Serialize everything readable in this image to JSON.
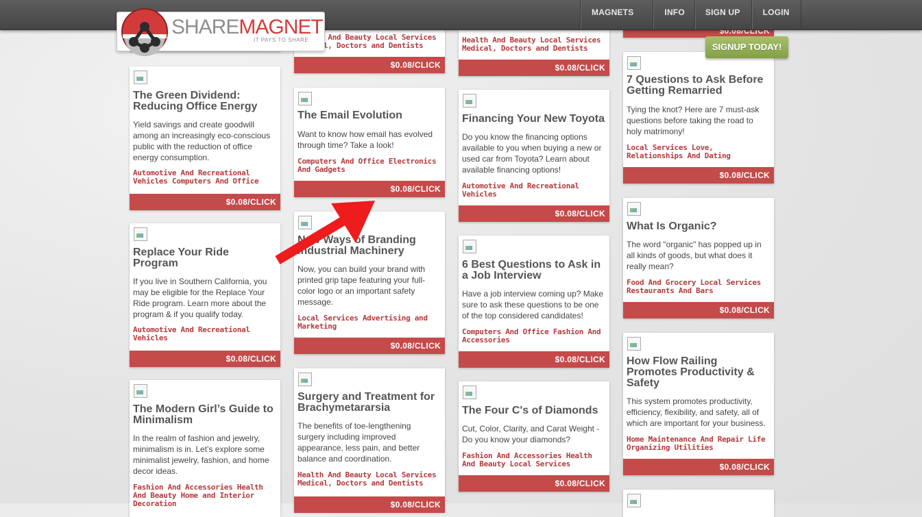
{
  "nav": {
    "items": [
      "MAGNETS",
      "INFO",
      "SIGN UP",
      "LOGIN"
    ],
    "signup_cta": "SIGNUP TODAY!"
  },
  "logo": {
    "part1": "SHARE",
    "part2": "MAGNET",
    "tagline": "IT PAYS TO SHARE"
  },
  "price": "$0.08/CLICK",
  "cards": [
    {
      "id": "c1a",
      "title": "",
      "desc": "",
      "cats": ""
    },
    {
      "id": "c1b",
      "title": "The Green Dividend: Reducing Office Energy",
      "desc": "Yield savings and create goodwill among an increasingly eco-conscious public with the reduction of office energy consumption.",
      "cats": "Automotive And Recreational Vehicles Computers And Office"
    },
    {
      "id": "c1c",
      "title": "Replace Your Ride Program",
      "desc": "If you live in Southern California, you may be eligible for the Replace Your Ride program. Learn more about the program & if you qualify today.",
      "cats": "Automotive And Recreational Vehicles"
    },
    {
      "id": "c1d",
      "title": "The Modern Girl’s Guide to Minimalism",
      "desc": "In the realm of fashion and jewelry, minimalism is in. Let’s explore some minimalist jewelry, fashion, and home decor ideas.",
      "cats": "Fashion And Accessories Health And Beauty Home and Interior Decoration"
    },
    {
      "id": "c2a",
      "title": "",
      "desc": "",
      "cats": "Health And Beauty Local Services Medical, Doctors and Dentists"
    },
    {
      "id": "c2b",
      "title": "The Email Evolution",
      "desc": "Want to know how email has evolved through time? Take a look!",
      "cats": "Computers And Office Electronics And Gadgets"
    },
    {
      "id": "c2c",
      "title": "New Ways of Branding Industrial Machinery",
      "desc": "Now, you can build your brand with printed grip tape featuring your full-color logo or an important safety message.",
      "cats": "Local Services Advertising and Marketing"
    },
    {
      "id": "c2d",
      "title": "Surgery and Treatment for Brachymetararsia",
      "desc": "The benefits of toe-lengthening surgery including improved appearance, less pain, and better balance and coordination.",
      "cats": "Health And Beauty Local Services Medical, Doctors and Dentists"
    },
    {
      "id": "c3a",
      "title": "",
      "desc": "",
      "cats": "Health And Beauty Local Services Medical, Doctors and Dentists"
    },
    {
      "id": "c3b",
      "title": "Financing Your New Toyota",
      "desc": "Do you know the financing options available to you when buying a new or used car from Toyota? Learn about available financing options!",
      "cats": "Automotive And Recreational Vehicles"
    },
    {
      "id": "c3c",
      "title": "6 Best Questions to Ask in a Job Interview",
      "desc": "Have a job interview coming up? Make sure to ask these questions to be one of the top considered candidates!",
      "cats": "Computers And Office Fashion And Accessories"
    },
    {
      "id": "c3d",
      "title": "The Four C's of Diamonds",
      "desc": "Cut, Color, Clarity, and Carat Weight - Do you know your diamonds?",
      "cats": "Fashion And Accessories Health And Beauty Local Services"
    },
    {
      "id": "c4a",
      "title": "",
      "desc": "",
      "cats": ""
    },
    {
      "id": "c4b",
      "title": "7 Questions to Ask Before Getting Remarried",
      "desc": "Tying the knot? Here are 7 must-ask questions before taking the road to holy matrimony!",
      "cats": "Local Services Love, Relationships And Dating"
    },
    {
      "id": "c4c",
      "title": "What Is Organic?",
      "desc": "The word \"organic\" has popped up in all kinds of goods, but what does it really mean?",
      "cats": "Food And Grocery Local Services Restaurants And Bars"
    },
    {
      "id": "c4d",
      "title": "How Flow Railing Promotes Productivity & Safety",
      "desc": "This system promotes productivity, efficiency, flexibility, and safety, all of which are important for your business.",
      "cats": "Home Maintenance And Repair Life Organizing Utilities"
    }
  ]
}
